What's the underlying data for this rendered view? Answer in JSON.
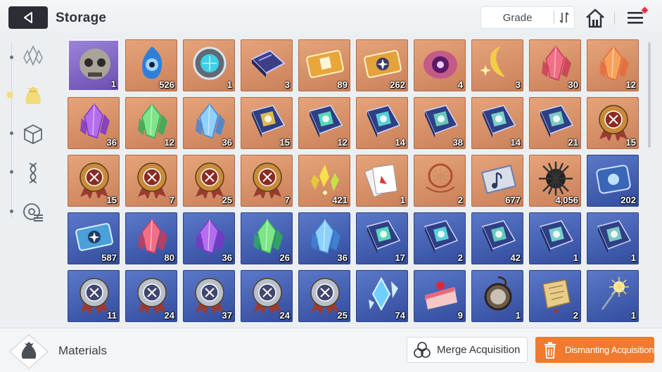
{
  "header": {
    "title": "Storage",
    "sort_label": "Grade"
  },
  "sidebar": {
    "tabs": [
      {
        "name": "crystal-icon"
      },
      {
        "name": "material-pouch-icon",
        "active": true
      },
      {
        "name": "cube-icon"
      },
      {
        "name": "dna-icon"
      },
      {
        "name": "record-icon"
      }
    ]
  },
  "footer": {
    "category_label": "Materials",
    "merge_label": "Merge Acquisition",
    "dismantle_label": "Dismanting Acquisition"
  },
  "colors": {
    "accent": "#f07a2e",
    "orange_cell": "#d28c65",
    "blue_cell": "#3f5aac",
    "purple_cell": "#7d63c4"
  },
  "items": [
    {
      "icon": "skull-mask",
      "rarity": "purple",
      "count": "1"
    },
    {
      "icon": "blue-flame-orb",
      "rarity": "orange",
      "count": "526"
    },
    {
      "icon": "tech-ring",
      "rarity": "orange",
      "count": "1"
    },
    {
      "icon": "chip-module",
      "rarity": "orange",
      "count": "3"
    },
    {
      "icon": "id-ticket",
      "rarity": "orange",
      "count": "89"
    },
    {
      "icon": "star-ticket",
      "rarity": "orange",
      "count": "262"
    },
    {
      "icon": "purple-eye",
      "rarity": "orange",
      "count": "4"
    },
    {
      "icon": "gold-moon-sparkle",
      "rarity": "orange",
      "count": "3"
    },
    {
      "icon": "red-crystal",
      "rarity": "orange",
      "count": "30"
    },
    {
      "icon": "orange-crystal",
      "rarity": "orange",
      "count": "12"
    },
    {
      "icon": "purple-crystal",
      "rarity": "orange",
      "count": "36"
    },
    {
      "icon": "green-crystal",
      "rarity": "orange",
      "count": "12"
    },
    {
      "icon": "blue-crystal",
      "rarity": "orange",
      "count": "36"
    },
    {
      "icon": "book-swords",
      "rarity": "orange",
      "count": "15"
    },
    {
      "icon": "book-shield",
      "rarity": "orange",
      "count": "12"
    },
    {
      "icon": "book-eye",
      "rarity": "orange",
      "count": "14"
    },
    {
      "icon": "book-wings",
      "rarity": "orange",
      "count": "38"
    },
    {
      "icon": "book-slash",
      "rarity": "orange",
      "count": "14"
    },
    {
      "icon": "book-target",
      "rarity": "orange",
      "count": "21"
    },
    {
      "icon": "medal-swords",
      "rarity": "orange",
      "count": "15"
    },
    {
      "icon": "medal-shield",
      "rarity": "orange",
      "count": "15"
    },
    {
      "icon": "medal-eye",
      "rarity": "orange",
      "count": "7"
    },
    {
      "icon": "medal-cross",
      "rarity": "orange",
      "count": "25"
    },
    {
      "icon": "medal-slash",
      "rarity": "orange",
      "count": "7"
    },
    {
      "icon": "gold-shards",
      "rarity": "orange",
      "count": "421"
    },
    {
      "icon": "card-deck",
      "rarity": "orange",
      "count": "1"
    },
    {
      "icon": "dreamcatcher",
      "rarity": "orange",
      "count": "2"
    },
    {
      "icon": "music-scroll",
      "rarity": "orange",
      "count": "677"
    },
    {
      "icon": "black-urchin",
      "rarity": "orange",
      "count": "4,056"
    },
    {
      "icon": "blue-device",
      "rarity": "blue",
      "count": "202"
    },
    {
      "icon": "blue-star-ticket",
      "rarity": "blue",
      "count": "587"
    },
    {
      "icon": "red-crystal",
      "rarity": "blue",
      "count": "80"
    },
    {
      "icon": "purple-crystal",
      "rarity": "blue",
      "count": "36"
    },
    {
      "icon": "green-crystal",
      "rarity": "blue",
      "count": "26"
    },
    {
      "icon": "blue-crystal",
      "rarity": "blue",
      "count": "36"
    },
    {
      "icon": "book-shield",
      "rarity": "blue",
      "count": "17"
    },
    {
      "icon": "book-eye",
      "rarity": "blue",
      "count": "2"
    },
    {
      "icon": "book-wings",
      "rarity": "blue",
      "count": "42"
    },
    {
      "icon": "book-slash",
      "rarity": "blue",
      "count": "1"
    },
    {
      "icon": "book-target",
      "rarity": "blue",
      "count": "1"
    },
    {
      "icon": "silver-medal-shield",
      "rarity": "blue",
      "count": "11"
    },
    {
      "icon": "silver-medal-eye",
      "rarity": "blue",
      "count": "24"
    },
    {
      "icon": "silver-medal-cross",
      "rarity": "blue",
      "count": "37"
    },
    {
      "icon": "silver-medal-slash",
      "rarity": "blue",
      "count": "24"
    },
    {
      "icon": "silver-medal-target",
      "rarity": "blue",
      "count": "25"
    },
    {
      "icon": "ice-shard",
      "rarity": "blue",
      "count": "74"
    },
    {
      "icon": "strawberry-cake",
      "rarity": "blue",
      "count": "9"
    },
    {
      "icon": "pocket-watch",
      "rarity": "blue",
      "count": "1"
    },
    {
      "icon": "parchment-scroll",
      "rarity": "blue",
      "count": "2"
    },
    {
      "icon": "sparkler",
      "rarity": "blue",
      "count": "1"
    }
  ]
}
